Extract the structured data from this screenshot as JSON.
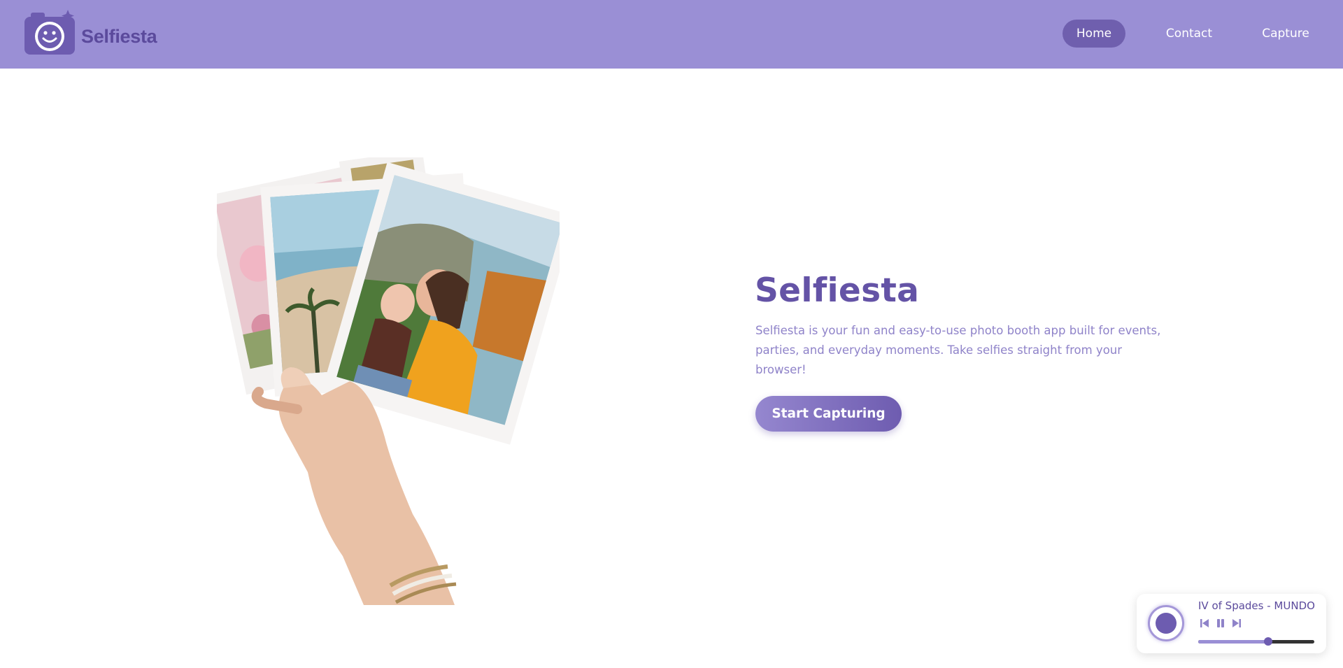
{
  "app": {
    "brand_name": "Selfiesta"
  },
  "nav": {
    "items": [
      {
        "label": "Home",
        "active": true
      },
      {
        "label": "Contact",
        "active": false
      },
      {
        "label": "Capture",
        "active": false
      }
    ]
  },
  "hero": {
    "title": "Selfiesta",
    "description": "Selfiesta is your fun and easy-to-use photo booth app built for events, parties, and everyday moments. Take selfies straight from your browser!",
    "cta_label": "Start Capturing",
    "image_icon": "photos-in-hand-image"
  },
  "player": {
    "track": "IV of Spades - MUNDO",
    "progress": 0.6,
    "icons": {
      "prev": "skip-previous-icon",
      "pause": "pause-icon",
      "next": "skip-next-icon",
      "disc": "disc-icon"
    }
  },
  "colors": {
    "nav_bg": "#9a8fd5",
    "accent": "#6453a6",
    "text_muted": "#8f83c9",
    "button_gradient_start": "#9587cf",
    "button_gradient_end": "#6e5cb0"
  }
}
